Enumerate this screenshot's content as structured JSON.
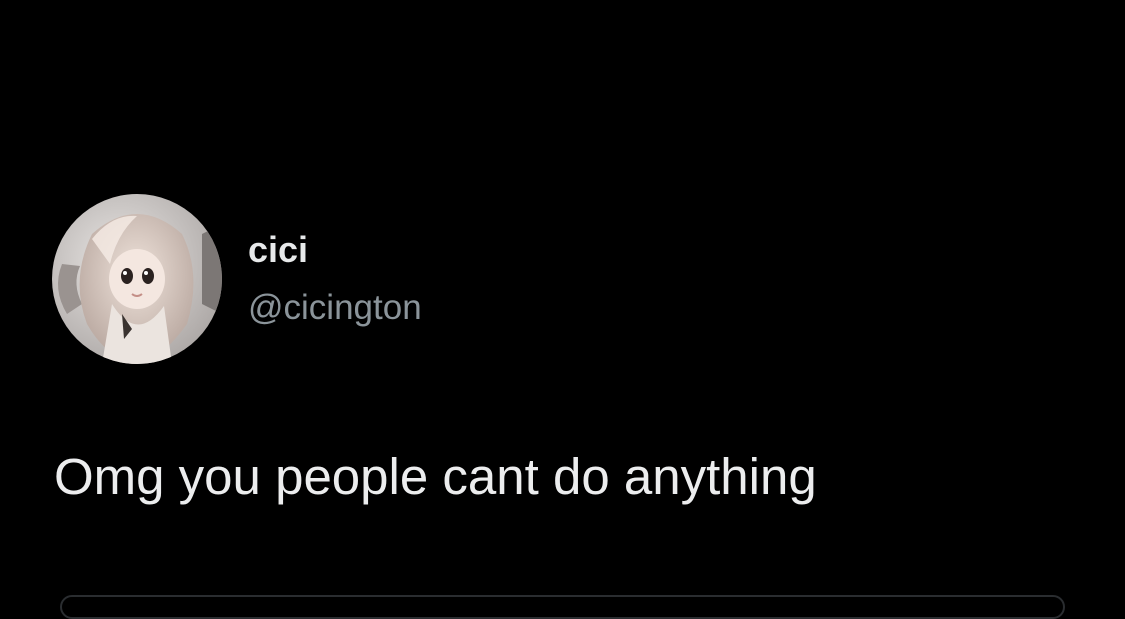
{
  "tweet": {
    "author": {
      "display_name": "cici",
      "handle": "@cicington",
      "avatar_icon": "doll-avatar-icon"
    },
    "text": "Omg you people cant do anything"
  },
  "colors": {
    "background": "#000000",
    "primary_text": "#e7e9ea",
    "secondary_text": "#8b949a"
  }
}
